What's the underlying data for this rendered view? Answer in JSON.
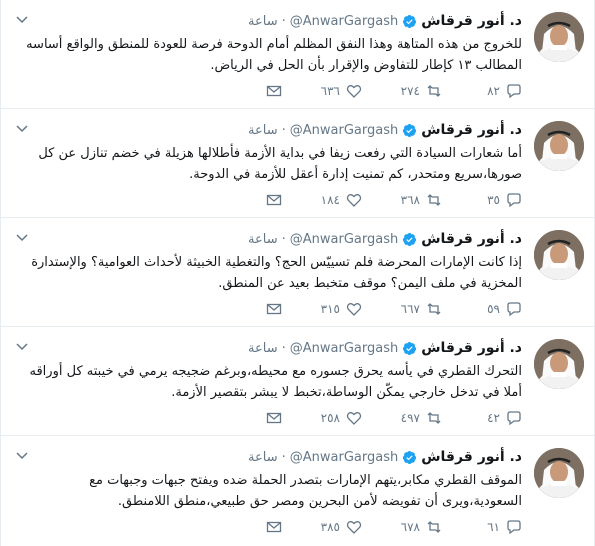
{
  "colors": {
    "text": "#14171a",
    "muted": "#657786",
    "verified": "#1da1f2",
    "divider": "#e6ecf0"
  },
  "tweets": [
    {
      "name": "د. أنور قرقاش",
      "handle": "@AnwarGargash",
      "time": "ساعة",
      "text": "للخروج من هذه المتاهة وهذا النفق المظلم أمام الدوحة فرصة للعودة للمنطق والواقع أساسه المطالب ١٣ كإطار للتفاوض والإقرار بأن الحل في الرياض.",
      "replies": "٨٢",
      "retweets": "٢٧٤",
      "likes": "٦٣٦"
    },
    {
      "name": "د. أنور قرقاش",
      "handle": "@AnwarGargash",
      "time": "ساعة",
      "text": "أما شعارات السيادة التي رفعت زيفا في بداية الأزمة فأطلالها هزيلة في خضم تنازل عن كل صورها،سريع ومتحدر، كم تمنيت إدارة أعقل للأزمة في الدوحة.",
      "replies": "٣٥",
      "retweets": "٣٦٨",
      "likes": "١٨٤"
    },
    {
      "name": "د. أنور قرقاش",
      "handle": "@AnwarGargash",
      "time": "ساعة",
      "text": "إذا كانت الإمارات المحرضة فلم تسييّس الحج؟ والتغطية الخبيثة لأحداث العوامية؟ والإستدارة المخزية في ملف اليمن؟ موقف متخبط بعيد عن المنطق.",
      "replies": "٥٩",
      "retweets": "٦٦٧",
      "likes": "٣١٥"
    },
    {
      "name": "د. أنور قرقاش",
      "handle": "@AnwarGargash",
      "time": "ساعة",
      "text": "التحرك القطري في يأسه يحرق جسوره مع محيطه،وبرغم ضجيجه يرمي في خيبته كل أوراقه أملا في تدخل خارجي يمكّن الوساطة،تخبط لا يبشر بتقصير الأزمة.",
      "replies": "٤٢",
      "retweets": "٤٩٧",
      "likes": "٢٥٨"
    },
    {
      "name": "د. أنور قرقاش",
      "handle": "@AnwarGargash",
      "time": "ساعة",
      "text": "الموقف القطري مكابر،يتهم الإمارات بتصدر الحملة ضده ويفتح جبهات وجبهات مع السعودية،ويرى أن تفويضه لأمن البحرين ومصر حق طبيعي،منطق اللامنطق.",
      "replies": "٦١",
      "retweets": "٦٧٨",
      "likes": "٣٨٥"
    }
  ]
}
